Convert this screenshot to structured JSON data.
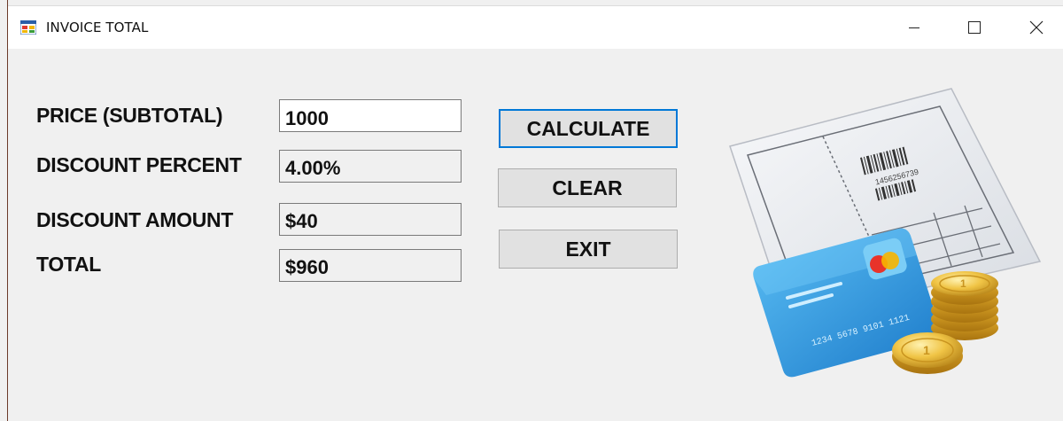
{
  "window": {
    "title": "INVOICE TOTAL",
    "controls": {
      "minimize": "minimize-icon",
      "maximize": "maximize-icon",
      "close": "close-icon"
    }
  },
  "form": {
    "price": {
      "label": "PRICE (SUBTOTAL)",
      "value": "1000"
    },
    "discount_percent": {
      "label": "DISCOUNT PERCENT",
      "value": "4.00%"
    },
    "discount_amount": {
      "label": "DISCOUNT AMOUNT",
      "value": "$40"
    },
    "total": {
      "label": "TOTAL",
      "value": "$960"
    }
  },
  "buttons": {
    "calculate": "CALCULATE",
    "clear": "CLEAR",
    "exit": "EXIT"
  },
  "illustration": {
    "barcode_number": "1456256739",
    "card_number": "1234 5678 9101 1121",
    "icon": "invoice-card-coins-illustration"
  },
  "colors": {
    "accent": "#0078d7",
    "card": "#2f9be0",
    "coin": "#e8b83a"
  }
}
